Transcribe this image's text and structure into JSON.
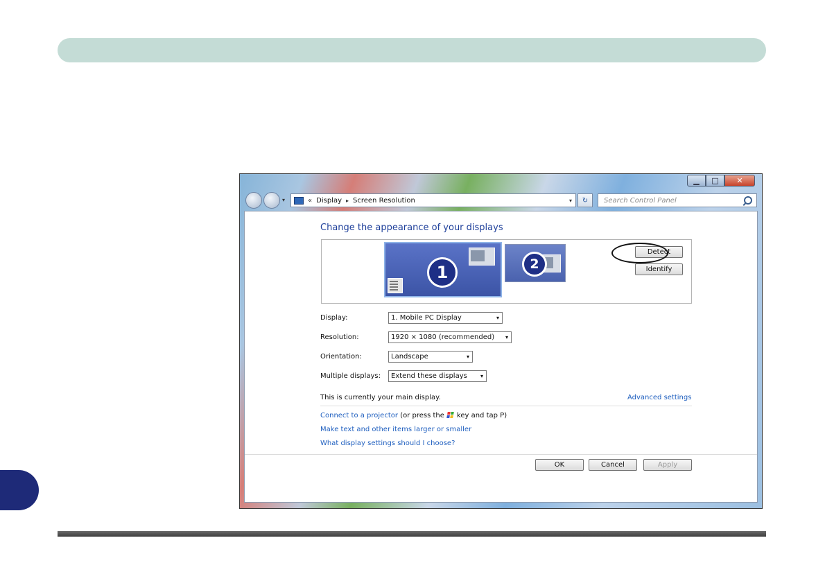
{
  "window": {
    "minimize_glyph": "▁",
    "maximize_glyph": "□",
    "close_glyph": "✕"
  },
  "nav": {
    "dropdown_glyph": "▾"
  },
  "address": {
    "prefix": "«",
    "crumb1": "Display",
    "crumb_sep": "▸",
    "crumb2": "Screen Resolution",
    "dropdown_glyph": "▾",
    "refresh_glyph": "↻"
  },
  "search": {
    "placeholder": "Search Control Panel"
  },
  "main": {
    "title": "Change the appearance of your displays",
    "monitor1_number": "1",
    "monitor2_number": "2",
    "detect_label": "Detect",
    "identify_label": "Identify",
    "display_label": "Display:",
    "display_value": "1. Mobile PC Display",
    "resolution_label": "Resolution:",
    "resolution_value": "1920 × 1080 (recommended)",
    "orientation_label": "Orientation:",
    "orientation_value": "Landscape",
    "multiple_label": "Multiple displays:",
    "multiple_value": "Extend these displays",
    "select_arrow": "▾",
    "status": "This is currently your main display.",
    "advanced_link": "Advanced settings",
    "connect_link": "Connect to a projector",
    "connect_mid": "(or press the",
    "connect_end": "key and tap P)",
    "text_size_link": "Make text and other items larger or smaller",
    "help_link": "What display settings should I choose?"
  },
  "footer": {
    "ok_label": "OK",
    "cancel_label": "Cancel",
    "apply_label": "Apply"
  }
}
